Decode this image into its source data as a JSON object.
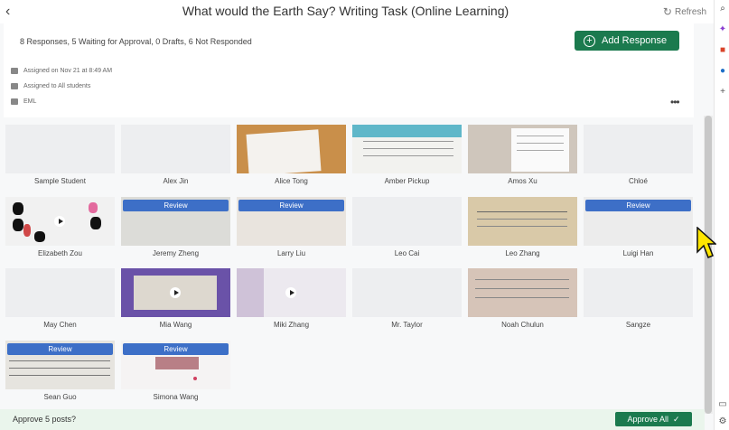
{
  "header": {
    "title": "What would the Earth Say? Writing Task (Online Learning)",
    "refresh_label": "Refresh"
  },
  "summary": {
    "status_text": "8 Responses, 5 Waiting for Approval, 0 Drafts, 6 Not Responded",
    "add_response_label": "Add Response",
    "assigned_date": "Assigned on Nov 21 at 8:49 AM",
    "assigned_to": "Assigned to All students",
    "folder": "EML"
  },
  "review_label": "Review",
  "students": [
    {
      "name": "Sample Student",
      "review": false
    },
    {
      "name": "Alex Jin",
      "review": false
    },
    {
      "name": "Alice Tong",
      "review": false
    },
    {
      "name": "Amber Pickup",
      "review": false
    },
    {
      "name": "Amos Xu",
      "review": false
    },
    {
      "name": "Chloé",
      "review": false
    },
    {
      "name": "Elizabeth Zou",
      "review": false
    },
    {
      "name": "Jeremy Zheng",
      "review": true
    },
    {
      "name": "Larry Liu",
      "review": true
    },
    {
      "name": "Leo Cai",
      "review": false
    },
    {
      "name": "Leo Zhang",
      "review": false
    },
    {
      "name": "Luigi Han",
      "review": true
    },
    {
      "name": "May Chen",
      "review": false
    },
    {
      "name": "Mia Wang",
      "review": false
    },
    {
      "name": "Miki Zhang",
      "review": false
    },
    {
      "name": "Mr. Taylor",
      "review": false
    },
    {
      "name": "Noah Chulun",
      "review": false
    },
    {
      "name": "Sangze",
      "review": false
    },
    {
      "name": "Sean Guo",
      "review": true
    },
    {
      "name": "Simona Wang",
      "review": true
    }
  ],
  "footer": {
    "approve_prompt": "Approve 5 posts?",
    "approve_all_label": "Approve All"
  },
  "colors": {
    "primary_green": "#1b7a4e",
    "review_blue": "#3d6fc7",
    "footer_bg": "#eaf5ec"
  }
}
